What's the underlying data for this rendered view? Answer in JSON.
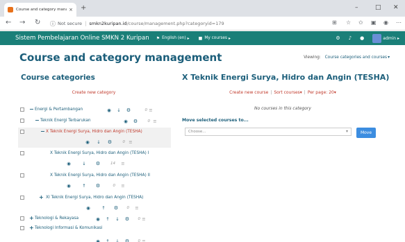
{
  "browser": {
    "tab_title": "Course and category managem",
    "tab_close": "×",
    "new_tab": "+",
    "not_secure": "Not secure",
    "url_host": "smkn2kuripan.id",
    "url_path": "/course/management.php?categoryid=179",
    "win_min": "–",
    "win_max": "□",
    "win_close": "✕"
  },
  "navbar": {
    "site_name": "Sistem Pembelajaran Online SMKN 2 Kuripan",
    "language": "English (en)",
    "my_courses": "My courses",
    "user": "admin"
  },
  "page": {
    "title": "Course and category management",
    "viewing_label": "Viewing:",
    "viewing_value": "Course categories and courses"
  },
  "left": {
    "heading": "Course categories",
    "create": "Create new category",
    "rows": [
      {
        "name": "Energi & Pertambangan",
        "toggle": "−",
        "count": "0"
      },
      {
        "name": "Teknik Energi Terbarukan",
        "toggle": "−",
        "count": "0"
      },
      {
        "name": "X Teknik Energi Surya, Hidro dan Angin (TESHA)",
        "toggle": "−",
        "count": "0"
      },
      {
        "name": "X Teknik Energi Surya, Hidro dan Angin (TESHA) I",
        "toggle": "",
        "count": "14"
      },
      {
        "name": "X Teknik Energi Surya, Hidro dan Angin (TESHA) II",
        "toggle": "",
        "count": "0"
      },
      {
        "name": "XI Teknik Energi Surya, Hidro dan Angin (TESHA)",
        "toggle": "+",
        "count": "0"
      },
      {
        "name": "Teknologi & Rekayasa",
        "toggle": "+",
        "count": "0"
      },
      {
        "name": "Teknologi Informasi & Komunikasi",
        "toggle": "+",
        "count": "0"
      }
    ]
  },
  "right": {
    "heading": "X Teknik Energi Surya, Hidro dan Angin (TESHA)",
    "create_course": "Create new course",
    "sort_courses": "Sort courses",
    "per_page": "Per page: 20",
    "no_courses": "No courses in this category",
    "move_label": "Move selected courses to...",
    "choose": "Choose...",
    "move_button": "Move"
  },
  "colors": {
    "navbar": "#1a7f78",
    "heading": "#1b5e7a",
    "link": "#c0392b",
    "button": "#3c8de0"
  }
}
